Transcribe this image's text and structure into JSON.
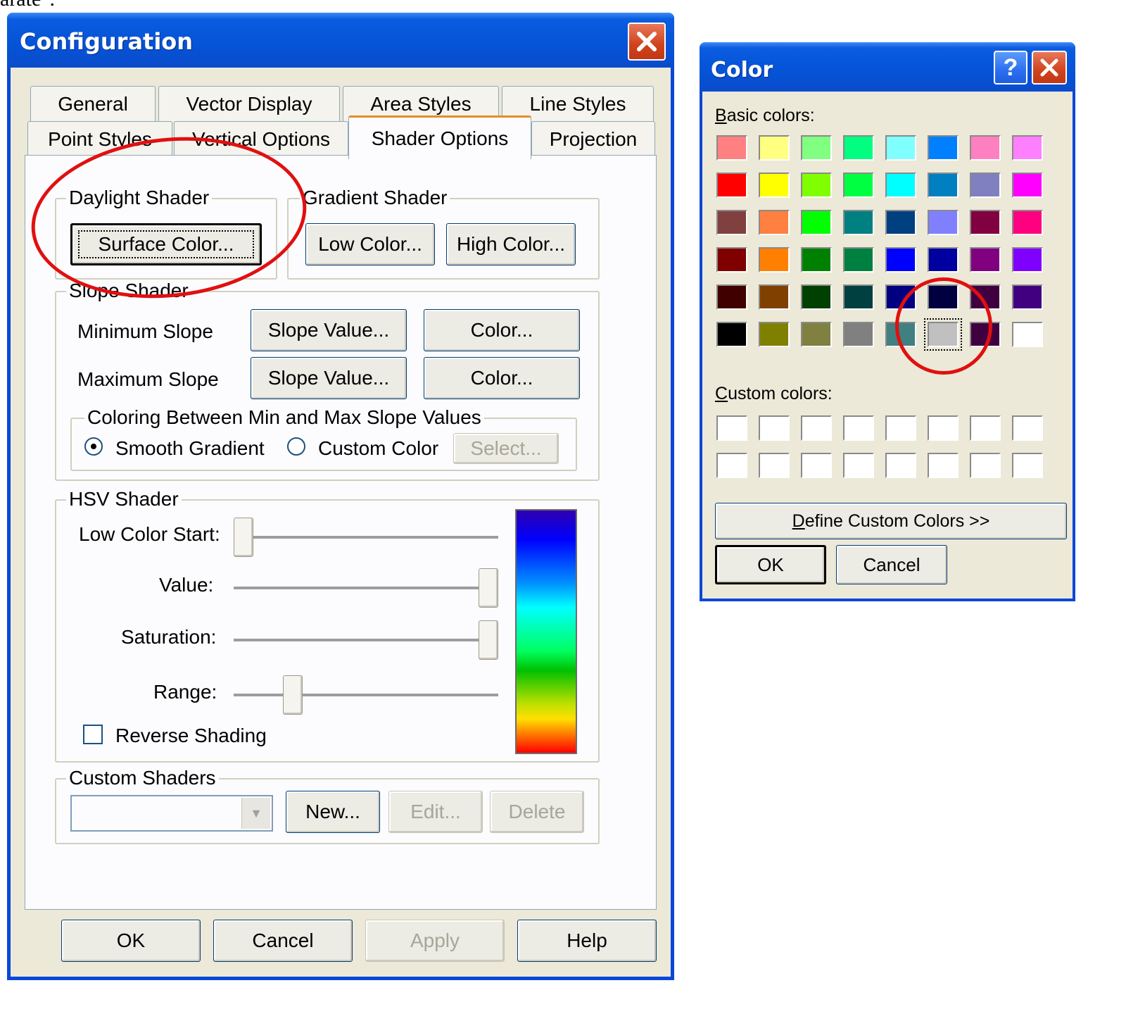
{
  "top_fragment": "arate\".",
  "config": {
    "title": "Configuration",
    "tabs_row1": [
      "General",
      "Vector Display",
      "Area Styles",
      "Line Styles"
    ],
    "tabs_row2": [
      "Point Styles",
      "Vertical Options",
      "Shader Options",
      "Projection"
    ],
    "active_tab": "Shader Options",
    "daylight": {
      "legend": "Daylight Shader",
      "surface_button": "Surface Color..."
    },
    "gradient": {
      "legend": "Gradient Shader",
      "low_button": "Low Color...",
      "high_button": "High Color..."
    },
    "slope": {
      "legend": "Slope Shader",
      "min_label": "Minimum Slope",
      "max_label": "Maximum Slope",
      "slope_value_button": "Slope Value...",
      "color_button": "Color...",
      "between_legend": "Coloring Between Min and Max Slope Values",
      "smooth_label": "Smooth Gradient",
      "custom_label": "Custom Color",
      "select_button": "Select...",
      "selected_option": "Smooth Gradient"
    },
    "hsv": {
      "legend": "HSV Shader",
      "low_start_label": "Low Color Start:",
      "value_label": "Value:",
      "saturation_label": "Saturation:",
      "range_label": "Range:",
      "reverse_label": "Reverse Shading",
      "low_start_pos": 0.0,
      "value_pos": 1.0,
      "saturation_pos": 1.0,
      "range_pos": 0.2
    },
    "custom": {
      "legend": "Custom Shaders",
      "combo_value": "",
      "new_button": "New...",
      "edit_button": "Edit...",
      "delete_button": "Delete"
    },
    "footer": {
      "ok": "OK",
      "cancel": "Cancel",
      "apply": "Apply",
      "help": "Help"
    }
  },
  "color": {
    "title": "Color",
    "help_glyph": "?",
    "basic_label_u": "B",
    "basic_label_rest": "asic colors:",
    "custom_label_u": "C",
    "custom_label_rest": "ustom colors:",
    "define_u": "D",
    "define_rest": "efine Custom Colors >>",
    "ok": "OK",
    "cancel": "Cancel",
    "selected_color": "#c0c0c0",
    "basic_colors": [
      [
        "#ff8080",
        "#ffff80",
        "#80ff80",
        "#00ff80",
        "#80ffff",
        "#0080ff",
        "#ff80c0",
        "#ff80ff"
      ],
      [
        "#ff0000",
        "#ffff00",
        "#80ff00",
        "#00ff40",
        "#00ffff",
        "#0080c0",
        "#8080c0",
        "#ff00ff"
      ],
      [
        "#804040",
        "#ff8040",
        "#00ff00",
        "#008080",
        "#004080",
        "#8080ff",
        "#800040",
        "#ff0080"
      ],
      [
        "#800000",
        "#ff8000",
        "#008000",
        "#008040",
        "#0000ff",
        "#0000a0",
        "#800080",
        "#8000ff"
      ],
      [
        "#400000",
        "#804000",
        "#004000",
        "#004040",
        "#000080",
        "#000040",
        "#400040",
        "#400080"
      ],
      [
        "#000000",
        "#808000",
        "#808040",
        "#808080",
        "#408080",
        "#c0c0c0",
        "#400040",
        "#ffffff"
      ]
    ],
    "custom_colors": [
      [
        "#ffffff",
        "#ffffff",
        "#ffffff",
        "#ffffff",
        "#ffffff",
        "#ffffff",
        "#ffffff",
        "#ffffff"
      ],
      [
        "#ffffff",
        "#ffffff",
        "#ffffff",
        "#ffffff",
        "#ffffff",
        "#ffffff",
        "#ffffff",
        "#ffffff"
      ]
    ]
  }
}
